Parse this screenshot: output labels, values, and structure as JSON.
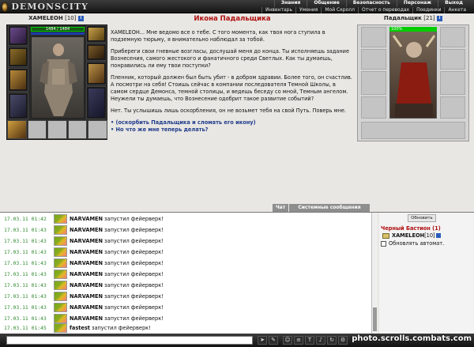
{
  "app": {
    "logo": "DEMONSCITY"
  },
  "top_menu": [
    "Знания",
    "Общение",
    "Безопасность",
    "Персонаж",
    "Выход"
  ],
  "sub_menu": [
    "Инвентарь",
    "Умения",
    "Мой Скролл",
    "Отчет о переводах",
    "Поединки",
    "Анкета"
  ],
  "player": {
    "name": "XAMELEOH",
    "level": "[10]",
    "hp": "1484 / 1484",
    "info": "i"
  },
  "npc": {
    "name": "Падальщик",
    "level": "[21]",
    "hp": "100%",
    "info": "i"
  },
  "dialog": {
    "title": "Икона Падальщика",
    "paragraphs": [
      "XAMELEOH... Мне ведомо все о тебе. С того момента, как твоя нога ступила в подземную тюрьму, я внимательно наблюдал за тобой.",
      "Прибереги свои гневные возгласы, дослушай меня до конца. Ты исполняешь задание Вознесения, самого жестокого и фанатичного среди Светлых. Как ты думаешь, понравились ли ему твои поступки?",
      "Пленник, который должен был быть убит - в добром здравии. Более того, он счастлив. А посмотри на себя! Стоишь сейчас в компании последователя Темной Школы, в самом сердце Демонса, темной столицы, и ведешь беседу со мной, Темным ангелом. Неужели ты думаешь, что Вознесение одобрит такое развитие событий?",
      "Нет. Ты услышишь лишь оскорбления, он не возьмет тебя на свой Путь. Поверь мне."
    ],
    "choices": [
      "(оскорбить Падальщика и сломать его икону)",
      "Но что же мне теперь делать?"
    ]
  },
  "tabs": {
    "chat": "Чат",
    "system": "Системные сообщения"
  },
  "chat": [
    {
      "time": "17.03.11  01:42",
      "name": "NARVAMEN",
      "msg": "запустил фейерверк!"
    },
    {
      "time": "17.03.11  01:43",
      "name": "NARVAMEN",
      "msg": "запустил фейерверк!"
    },
    {
      "time": "17.03.11  01:43",
      "name": "NARVAMEN",
      "msg": "запустил фейерверк!"
    },
    {
      "time": "17.03.11  01:43",
      "name": "NARVAMEN",
      "msg": "запустил фейерверк!"
    },
    {
      "time": "17.03.11  01:43",
      "name": "NARVAMEN",
      "msg": "запустил фейерверк!"
    },
    {
      "time": "17.03.11  01:43",
      "name": "NARVAMEN",
      "msg": "запустил фейерверк!"
    },
    {
      "time": "17.03.11  01:43",
      "name": "NARVAMEN",
      "msg": "запустил фейерверк!"
    },
    {
      "time": "17.03.11  01:43",
      "name": "NARVAMEN",
      "msg": "запустил фейерверк!"
    },
    {
      "time": "17.03.11  01:43",
      "name": "NARVAMEN",
      "msg": "запустил фейерверк!"
    },
    {
      "time": "17.03.11  01:43",
      "name": "NARVAMEN",
      "msg": "запустил фейерверк!"
    },
    {
      "time": "17.03.11  01:45",
      "name": "fastest",
      "msg": "запустил фейерверк!"
    }
  ],
  "online": {
    "refresh_label": "Обновить",
    "location": "Черный Бастион (1)",
    "user_name": "XAMELEOH",
    "user_level": "[10]",
    "auto_label": "Обновлять автомат."
  },
  "watermark": "photo.scrolls.combats.com",
  "colors": {
    "accent_red": "#b01010",
    "link_blue": "#1f3c8c",
    "time_green": "#2e8a2e"
  }
}
